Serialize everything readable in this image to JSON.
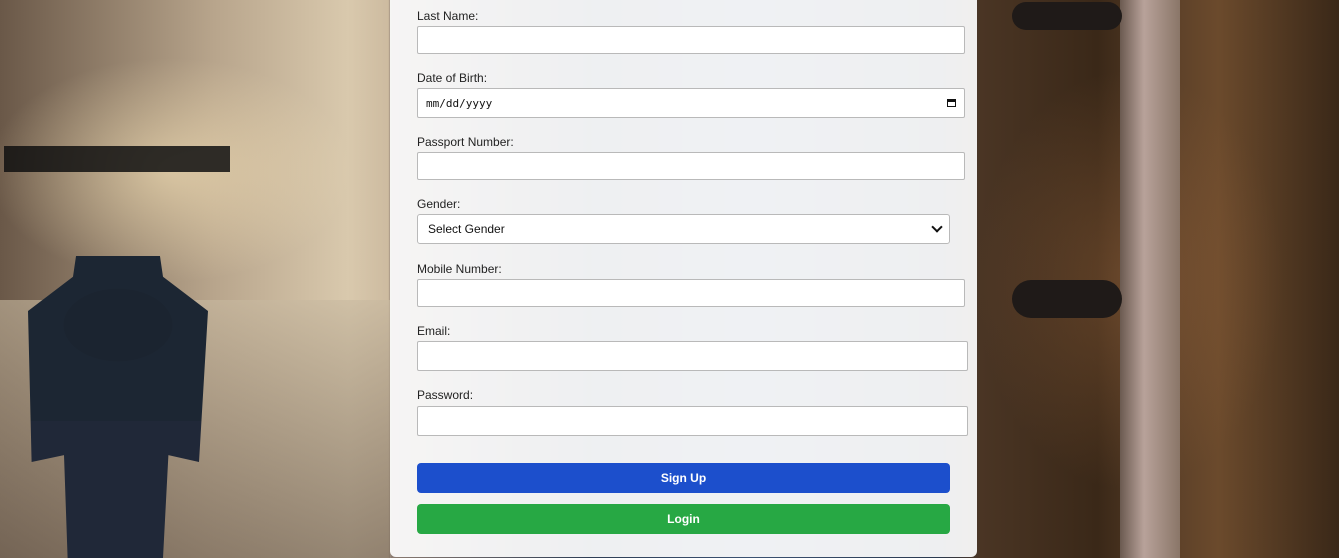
{
  "form": {
    "last_name": {
      "label": "Last Name:",
      "value": ""
    },
    "dob": {
      "label": "Date of Birth:",
      "placeholder": "mm/dd/yyyy"
    },
    "passport": {
      "label": "Passport Number:",
      "value": ""
    },
    "gender": {
      "label": "Gender:",
      "selected": "Select Gender"
    },
    "mobile": {
      "label": "Mobile Number:",
      "value": ""
    },
    "email": {
      "label": "Email:",
      "value": ""
    },
    "password": {
      "label": "Password:",
      "value": ""
    },
    "signup_label": "Sign Up",
    "login_label": "Login"
  },
  "colors": {
    "signup": "#1c4fcc",
    "login": "#27a844"
  },
  "icons": {
    "calendar": "calendar-icon",
    "select_arrow": "chevron-down-icon"
  }
}
